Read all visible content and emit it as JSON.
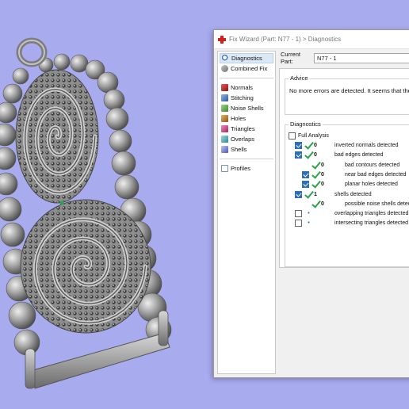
{
  "window": {
    "title": "Fix Wizard (Part: N77 - 1) > Diagnostics"
  },
  "nav": {
    "top": [
      {
        "label": "Diagnostics",
        "icon": "magnifier-icon",
        "selected": true
      },
      {
        "label": "Combined Fix",
        "icon": "combined-fix-icon",
        "selected": false
      }
    ],
    "fixes": [
      {
        "label": "Normals",
        "icon": "normals-icon"
      },
      {
        "label": "Stitching",
        "icon": "stitching-icon"
      },
      {
        "label": "Noise Shells",
        "icon": "noise-shells-icon"
      },
      {
        "label": "Holes",
        "icon": "holes-icon"
      },
      {
        "label": "Triangles",
        "icon": "triangles-icon"
      },
      {
        "label": "Overlaps",
        "icon": "overlaps-icon"
      },
      {
        "label": "Shells",
        "icon": "shells-icon"
      }
    ],
    "bottom": [
      {
        "label": "Profiles",
        "icon": "profiles-icon"
      }
    ]
  },
  "part": {
    "label": "Current Part:",
    "value": "N77 - 1"
  },
  "advice": {
    "title": "Advice",
    "message": "No more errors are detected. It seems that the par"
  },
  "diagnostics": {
    "title": "Diagnostics",
    "full_analysis_label": "Full Analysis",
    "full_analysis_checked": false,
    "rows": [
      {
        "indent": 0,
        "checked": true,
        "mark": "tick",
        "count": "0",
        "text": "inverted normals detected"
      },
      {
        "indent": 0,
        "checked": true,
        "mark": "tick",
        "count": "0",
        "text": "bad edges detected"
      },
      {
        "indent": 1,
        "checked": null,
        "mark": "tick",
        "count": "0",
        "text": "bad contours detected"
      },
      {
        "indent": 1,
        "checked": true,
        "mark": "tick",
        "count": "0",
        "text": "near bad edges detected"
      },
      {
        "indent": 1,
        "checked": true,
        "mark": "tick",
        "count": "0",
        "text": "planar holes detected"
      },
      {
        "indent": 0,
        "checked": true,
        "mark": "tick",
        "count": "1",
        "text": "shells detected"
      },
      {
        "indent": 1,
        "checked": null,
        "mark": "tick",
        "count": "0",
        "text": "possible noise shells detec"
      },
      {
        "indent": 0,
        "checked": false,
        "mark": "dot",
        "count": "",
        "text": "overlapping triangles detected"
      },
      {
        "indent": 0,
        "checked": false,
        "mark": "dot",
        "count": "",
        "text": "intersecting triangles detected"
      }
    ]
  },
  "colors": {
    "viewport_background": "#a9abef",
    "model_gray": "#8a8a8a",
    "tick_green": "#2aa34a",
    "checkbox_blue": "#2f6fb8"
  }
}
